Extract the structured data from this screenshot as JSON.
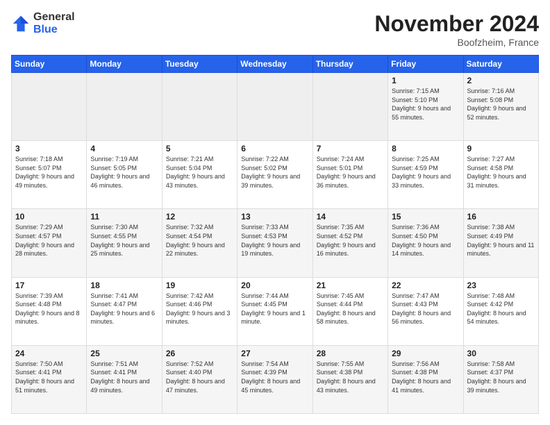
{
  "logo": {
    "general": "General",
    "blue": "Blue"
  },
  "title": "November 2024",
  "location": "Boofzheim, France",
  "days_header": [
    "Sunday",
    "Monday",
    "Tuesday",
    "Wednesday",
    "Thursday",
    "Friday",
    "Saturday"
  ],
  "weeks": [
    [
      {
        "num": "",
        "info": ""
      },
      {
        "num": "",
        "info": ""
      },
      {
        "num": "",
        "info": ""
      },
      {
        "num": "",
        "info": ""
      },
      {
        "num": "",
        "info": ""
      },
      {
        "num": "1",
        "info": "Sunrise: 7:15 AM\nSunset: 5:10 PM\nDaylight: 9 hours and 55 minutes."
      },
      {
        "num": "2",
        "info": "Sunrise: 7:16 AM\nSunset: 5:08 PM\nDaylight: 9 hours and 52 minutes."
      }
    ],
    [
      {
        "num": "3",
        "info": "Sunrise: 7:18 AM\nSunset: 5:07 PM\nDaylight: 9 hours and 49 minutes."
      },
      {
        "num": "4",
        "info": "Sunrise: 7:19 AM\nSunset: 5:05 PM\nDaylight: 9 hours and 46 minutes."
      },
      {
        "num": "5",
        "info": "Sunrise: 7:21 AM\nSunset: 5:04 PM\nDaylight: 9 hours and 43 minutes."
      },
      {
        "num": "6",
        "info": "Sunrise: 7:22 AM\nSunset: 5:02 PM\nDaylight: 9 hours and 39 minutes."
      },
      {
        "num": "7",
        "info": "Sunrise: 7:24 AM\nSunset: 5:01 PM\nDaylight: 9 hours and 36 minutes."
      },
      {
        "num": "8",
        "info": "Sunrise: 7:25 AM\nSunset: 4:59 PM\nDaylight: 9 hours and 33 minutes."
      },
      {
        "num": "9",
        "info": "Sunrise: 7:27 AM\nSunset: 4:58 PM\nDaylight: 9 hours and 31 minutes."
      }
    ],
    [
      {
        "num": "10",
        "info": "Sunrise: 7:29 AM\nSunset: 4:57 PM\nDaylight: 9 hours and 28 minutes."
      },
      {
        "num": "11",
        "info": "Sunrise: 7:30 AM\nSunset: 4:55 PM\nDaylight: 9 hours and 25 minutes."
      },
      {
        "num": "12",
        "info": "Sunrise: 7:32 AM\nSunset: 4:54 PM\nDaylight: 9 hours and 22 minutes."
      },
      {
        "num": "13",
        "info": "Sunrise: 7:33 AM\nSunset: 4:53 PM\nDaylight: 9 hours and 19 minutes."
      },
      {
        "num": "14",
        "info": "Sunrise: 7:35 AM\nSunset: 4:52 PM\nDaylight: 9 hours and 16 minutes."
      },
      {
        "num": "15",
        "info": "Sunrise: 7:36 AM\nSunset: 4:50 PM\nDaylight: 9 hours and 14 minutes."
      },
      {
        "num": "16",
        "info": "Sunrise: 7:38 AM\nSunset: 4:49 PM\nDaylight: 9 hours and 11 minutes."
      }
    ],
    [
      {
        "num": "17",
        "info": "Sunrise: 7:39 AM\nSunset: 4:48 PM\nDaylight: 9 hours and 8 minutes."
      },
      {
        "num": "18",
        "info": "Sunrise: 7:41 AM\nSunset: 4:47 PM\nDaylight: 9 hours and 6 minutes."
      },
      {
        "num": "19",
        "info": "Sunrise: 7:42 AM\nSunset: 4:46 PM\nDaylight: 9 hours and 3 minutes."
      },
      {
        "num": "20",
        "info": "Sunrise: 7:44 AM\nSunset: 4:45 PM\nDaylight: 9 hours and 1 minute."
      },
      {
        "num": "21",
        "info": "Sunrise: 7:45 AM\nSunset: 4:44 PM\nDaylight: 8 hours and 58 minutes."
      },
      {
        "num": "22",
        "info": "Sunrise: 7:47 AM\nSunset: 4:43 PM\nDaylight: 8 hours and 56 minutes."
      },
      {
        "num": "23",
        "info": "Sunrise: 7:48 AM\nSunset: 4:42 PM\nDaylight: 8 hours and 54 minutes."
      }
    ],
    [
      {
        "num": "24",
        "info": "Sunrise: 7:50 AM\nSunset: 4:41 PM\nDaylight: 8 hours and 51 minutes."
      },
      {
        "num": "25",
        "info": "Sunrise: 7:51 AM\nSunset: 4:41 PM\nDaylight: 8 hours and 49 minutes."
      },
      {
        "num": "26",
        "info": "Sunrise: 7:52 AM\nSunset: 4:40 PM\nDaylight: 8 hours and 47 minutes."
      },
      {
        "num": "27",
        "info": "Sunrise: 7:54 AM\nSunset: 4:39 PM\nDaylight: 8 hours and 45 minutes."
      },
      {
        "num": "28",
        "info": "Sunrise: 7:55 AM\nSunset: 4:38 PM\nDaylight: 8 hours and 43 minutes."
      },
      {
        "num": "29",
        "info": "Sunrise: 7:56 AM\nSunset: 4:38 PM\nDaylight: 8 hours and 41 minutes."
      },
      {
        "num": "30",
        "info": "Sunrise: 7:58 AM\nSunset: 4:37 PM\nDaylight: 8 hours and 39 minutes."
      }
    ]
  ]
}
